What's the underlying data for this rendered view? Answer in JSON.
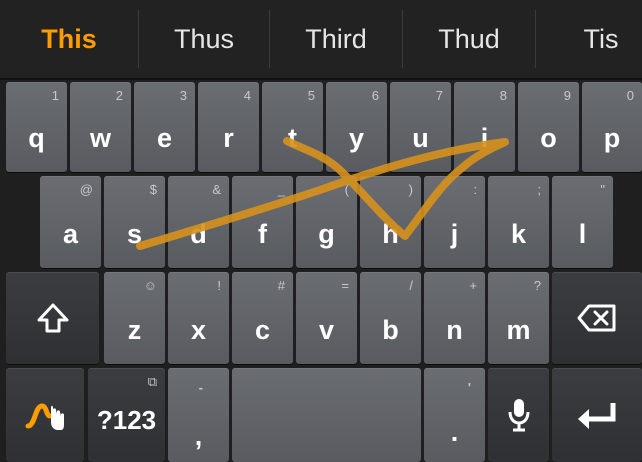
{
  "suggestions": [
    "This",
    "Thus",
    "Third",
    "Thud",
    "Tis"
  ],
  "rows": {
    "row1": [
      {
        "label": "q",
        "hint": "1"
      },
      {
        "label": "w",
        "hint": "2"
      },
      {
        "label": "e",
        "hint": "3"
      },
      {
        "label": "r",
        "hint": "4"
      },
      {
        "label": "t",
        "hint": "5"
      },
      {
        "label": "y",
        "hint": "6"
      },
      {
        "label": "u",
        "hint": "7"
      },
      {
        "label": "i",
        "hint": "8"
      },
      {
        "label": "o",
        "hint": "9"
      },
      {
        "label": "p",
        "hint": "0"
      }
    ],
    "row2": [
      {
        "label": "a",
        "hint": "@"
      },
      {
        "label": "s",
        "hint": "$"
      },
      {
        "label": "d",
        "hint": "&"
      },
      {
        "label": "f",
        "hint": "_"
      },
      {
        "label": "g",
        "hint": "("
      },
      {
        "label": "h",
        "hint": ")"
      },
      {
        "label": "j",
        "hint": ":"
      },
      {
        "label": "k",
        "hint": ";"
      },
      {
        "label": "l",
        "hint": "\""
      }
    ],
    "row3": [
      {
        "label": "z",
        "hint": "☺"
      },
      {
        "label": "x",
        "hint": "!"
      },
      {
        "label": "c",
        "hint": "#"
      },
      {
        "label": "v",
        "hint": "="
      },
      {
        "label": "b",
        "hint": "/"
      },
      {
        "label": "n",
        "hint": "+"
      },
      {
        "label": "m",
        "hint": "?"
      }
    ]
  },
  "bottom": {
    "symbols": "?123",
    "symbols_hint": "⧉",
    "comma": ",",
    "comma_hint": "-",
    "period": ".",
    "period_hint": "'"
  },
  "icons": {
    "shift": "shift-icon",
    "backspace": "backspace-icon",
    "gesture": "swype-gesture-icon",
    "mic": "microphone-icon",
    "enter": "enter-icon"
  },
  "colors": {
    "accent": "#ff9d00",
    "key": "#616468",
    "key_dark": "#34373a",
    "background": "#1f1f1f",
    "trail": "#d6911c"
  }
}
